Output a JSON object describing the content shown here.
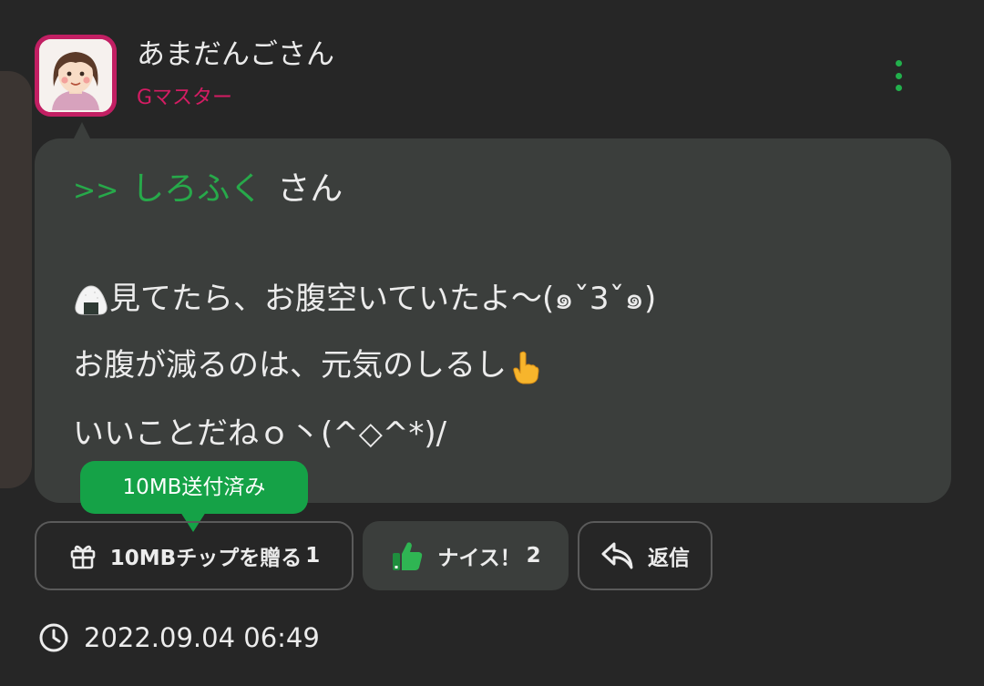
{
  "post": {
    "author_name": "あまだんごさん",
    "author_rank": "Gマスター",
    "reply_arrow": ">>",
    "reply_target": "しろふく",
    "reply_suffix": "さん",
    "lines": [
      "見てたら、お腹空いていたよ〜(๑ˇ3ˇ๑)",
      "お腹が減るのは、元気のしるし",
      "いいことだねｏ丶(^◇^*)/"
    ],
    "timestamp": "2022.09.04 06:49"
  },
  "tooltip": {
    "sent_label": "10MB送付済み"
  },
  "actions": {
    "tip_label": "10MBチップを贈る",
    "tip_count": "1",
    "nice_label": "ナイス！",
    "nice_count": "2",
    "reply_label": "返信"
  },
  "icons": {
    "avatar": "woman-avatar-icon",
    "more": "more-vertical-icon",
    "onigiri": "rice-ball-emoji",
    "point": "pointing-hand-emoji",
    "gift": "gift-icon",
    "thumbs": "thumbs-up-icon",
    "reply": "reply-arrow-icon",
    "clock": "clock-icon"
  },
  "colors": {
    "background": "#262626",
    "bubble": "#3b3e3c",
    "accent_green": "#27a94a",
    "rank_pink": "#d41c63",
    "tooltip_green": "#15a247"
  }
}
